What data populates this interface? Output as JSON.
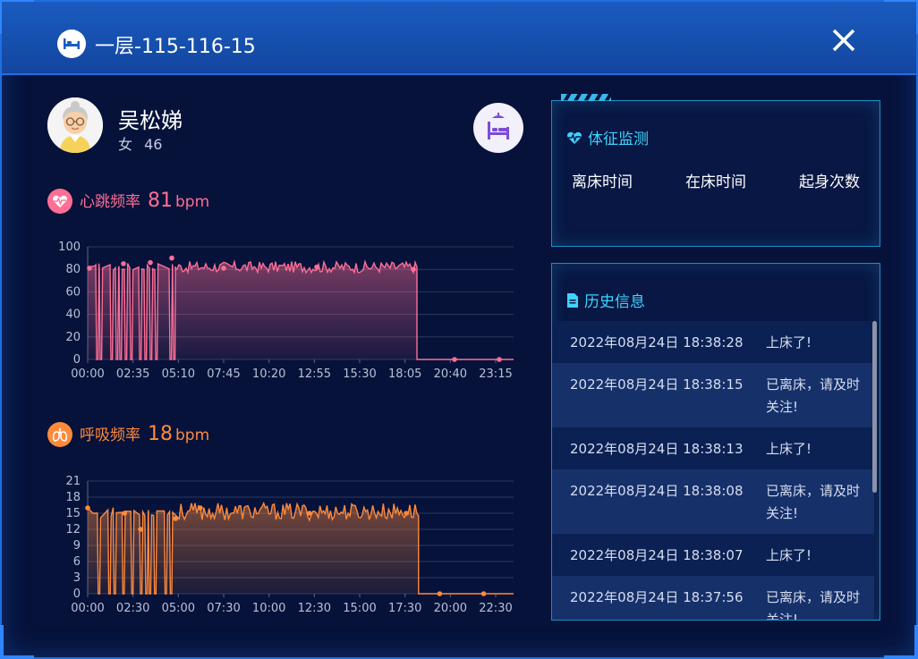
{
  "window": {
    "title": "一层-115-116-15",
    "close_glyph": "✕"
  },
  "patient": {
    "name": "吴松娣",
    "gender": "女",
    "age": "46"
  },
  "heart_rate": {
    "label": "心跳频率",
    "value": "81",
    "unit": "bpm",
    "color": "#ff6e95",
    "icon": "heart-pulse-icon"
  },
  "respiration": {
    "label": "呼吸频率",
    "value": "18",
    "unit": "bpm",
    "color": "#ff8a3c",
    "icon": "lungs-icon"
  },
  "vitals_panel": {
    "title": "体征监测",
    "labels": [
      "离床时间",
      "在床时间",
      "起身次数"
    ]
  },
  "history_panel": {
    "title": "历史信息",
    "rows": [
      {
        "time": "2022年08月24日 18:38:28",
        "msg": "上床了!"
      },
      {
        "time": "2022年08月24日 18:38:15",
        "msg": "已离床，请及时关注!"
      },
      {
        "time": "2022年08月24日 18:38:13",
        "msg": "上床了!"
      },
      {
        "time": "2022年08月24日 18:38:08",
        "msg": "已离床，请及时关注!"
      },
      {
        "time": "2022年08月24日 18:38:07",
        "msg": "上床了!"
      },
      {
        "time": "2022年08月24日 18:37:56",
        "msg": "已离床，请及时关注!"
      }
    ]
  },
  "chart_data": [
    {
      "type": "area",
      "series": [
        {
          "name": "",
          "color": "#ff6e95"
        }
      ],
      "x_ticks": [
        "00:00",
        "02:35",
        "05:10",
        "07:45",
        "10:20",
        "12:55",
        "15:30",
        "18:05",
        "20:40",
        "23:15"
      ],
      "y_ticks": [
        0,
        20,
        40,
        60,
        80,
        100
      ],
      "ylim": [
        0,
        100
      ],
      "grid": true,
      "segments": [
        {
          "x": [
            0,
            0.4
          ],
          "y": [
            82,
            83
          ]
        },
        {
          "drop_x": [
            0.5,
            0.7,
            1.3,
            1.6,
            1.8,
            2.1,
            2.4,
            2.9,
            3.2,
            3.5,
            3.8,
            4.6,
            4.8
          ]
        },
        {
          "x": [
            4.9,
            18.4
          ],
          "y_mean": 82,
          "y_jitter": 5
        },
        {
          "x": [
            18.4,
            23.8
          ],
          "y": [
            0,
            0
          ]
        }
      ],
      "markers": [
        {
          "x": 0.1,
          "y": 81
        },
        {
          "x": 2.0,
          "y": 85
        },
        {
          "x": 3.5,
          "y": 86
        },
        {
          "x": 4.7,
          "y": 90
        },
        {
          "x": 7.6,
          "y": 81
        },
        {
          "x": 12.8,
          "y": 82
        },
        {
          "x": 18.2,
          "y": 80
        },
        {
          "x": 20.5,
          "y": 0
        },
        {
          "x": 23.0,
          "y": 0
        }
      ],
      "x_range_hours": [
        0,
        23.8
      ]
    },
    {
      "type": "area",
      "series": [
        {
          "name": "",
          "color": "#ff8a3c"
        }
      ],
      "x_ticks": [
        "00:00",
        "02:30",
        "05:00",
        "07:30",
        "10:00",
        "12:30",
        "15:00",
        "17:30",
        "20:00",
        "22:30"
      ],
      "y_ticks": [
        0,
        3,
        6,
        9,
        12,
        15,
        18,
        21
      ],
      "ylim": [
        0,
        21
      ],
      "grid": true,
      "segments": [
        {
          "x": [
            0,
            0.3
          ],
          "y": [
            16,
            15
          ]
        },
        {
          "drop_x": [
            0.6,
            1.2,
            1.5,
            2.0,
            2.5,
            3.0,
            3.3,
            3.5,
            3.8,
            4.4,
            4.7
          ]
        },
        {
          "x": [
            5.2,
            18.8
          ],
          "y_mean": 15.3,
          "y_jitter": 1.6
        },
        {
          "x": [
            18.8,
            24.2
          ],
          "y": [
            0,
            0
          ]
        }
      ],
      "markers": [
        {
          "x": 0.0,
          "y": 16
        },
        {
          "x": 2.1,
          "y": 15
        },
        {
          "x": 3.0,
          "y": 12
        },
        {
          "x": 5.0,
          "y": 14
        },
        {
          "x": 6.4,
          "y": 16
        },
        {
          "x": 12.6,
          "y": 15
        },
        {
          "x": 18.1,
          "y": 15
        },
        {
          "x": 20.0,
          "y": 0
        },
        {
          "x": 22.5,
          "y": 0
        }
      ],
      "x_range_hours": [
        0,
        24.2
      ]
    }
  ]
}
